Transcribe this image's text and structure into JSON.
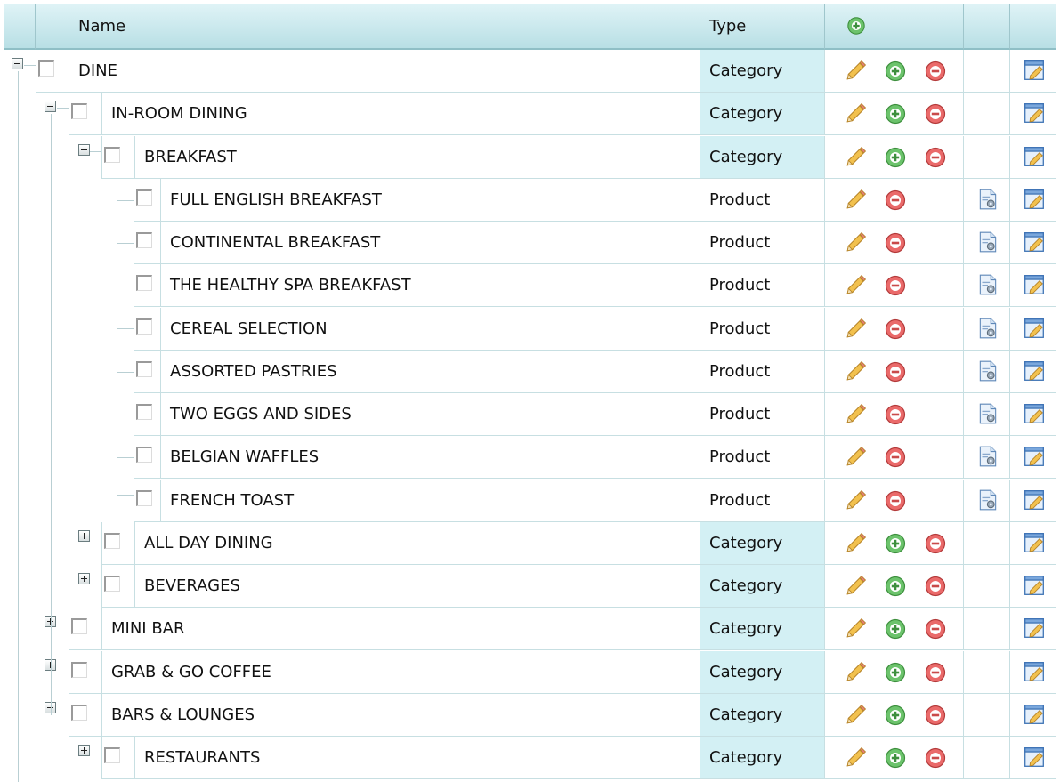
{
  "header": {
    "name_label": "Name",
    "type_label": "Type",
    "add_icon": "add-icon"
  },
  "colors": {
    "header_top": "#dff3f6",
    "header_bottom": "#b8dfe5",
    "category_bg": "#d3f0f4",
    "grid_line": "#c7dfe2",
    "add_green": "#5cb85c",
    "delete_red": "#e05a5a"
  },
  "rows": [
    {
      "name": "DINE",
      "type": "Category",
      "level": 0,
      "expander": "minus"
    },
    {
      "name": "IN-ROOM DINING",
      "type": "Category",
      "level": 1,
      "expander": "minus"
    },
    {
      "name": "BREAKFAST",
      "type": "Category",
      "level": 2,
      "expander": "minus"
    },
    {
      "name": "FULL ENGLISH BREAKFAST",
      "type": "Product",
      "level": 3,
      "expander": "none"
    },
    {
      "name": "CONTINENTAL BREAKFAST",
      "type": "Product",
      "level": 3,
      "expander": "none"
    },
    {
      "name": "THE HEALTHY SPA BREAKFAST",
      "type": "Product",
      "level": 3,
      "expander": "none"
    },
    {
      "name": "CEREAL SELECTION",
      "type": "Product",
      "level": 3,
      "expander": "none"
    },
    {
      "name": "ASSORTED PASTRIES",
      "type": "Product",
      "level": 3,
      "expander": "none"
    },
    {
      "name": "TWO EGGS AND SIDES",
      "type": "Product",
      "level": 3,
      "expander": "none"
    },
    {
      "name": "BELGIAN WAFFLES",
      "type": "Product",
      "level": 3,
      "expander": "none"
    },
    {
      "name": "FRENCH TOAST",
      "type": "Product",
      "level": 3,
      "expander": "none"
    },
    {
      "name": "ALL DAY DINING",
      "type": "Category",
      "level": 2,
      "expander": "plus"
    },
    {
      "name": "BEVERAGES",
      "type": "Category",
      "level": 2,
      "expander": "plus"
    },
    {
      "name": "MINI BAR",
      "type": "Category",
      "level": 1,
      "expander": "plus"
    },
    {
      "name": "GRAB & GO COFFEE",
      "type": "Category",
      "level": 1,
      "expander": "plus"
    },
    {
      "name": "BARS & LOUNGES",
      "type": "Category",
      "level": 1,
      "expander": "minus"
    },
    {
      "name": "RESTAURANTS",
      "type": "Category",
      "level": 2,
      "expander": "plus"
    }
  ],
  "icons": {
    "edit": "pencil-icon",
    "add": "add-icon",
    "delete": "delete-icon",
    "settings": "page-settings-icon",
    "properties": "edit-properties-icon"
  }
}
